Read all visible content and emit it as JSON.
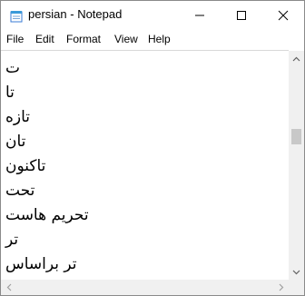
{
  "window": {
    "title": "persian - Notepad",
    "icon": "notepad-icon"
  },
  "menu": {
    "items": [
      "File",
      "Edit",
      "Format",
      "View",
      "Help"
    ]
  },
  "editor": {
    "lines": [
      "ت",
      "تا",
      "تازه",
      "تان",
      "تاکنون",
      "تحت",
      "تحریم هاست",
      "تر",
      "تر براساس"
    ]
  },
  "colors": {
    "window_border": "#8a8a8a",
    "scrollbar_track": "#f0f0f0",
    "scrollbar_thumb": "#c8c8c8"
  }
}
